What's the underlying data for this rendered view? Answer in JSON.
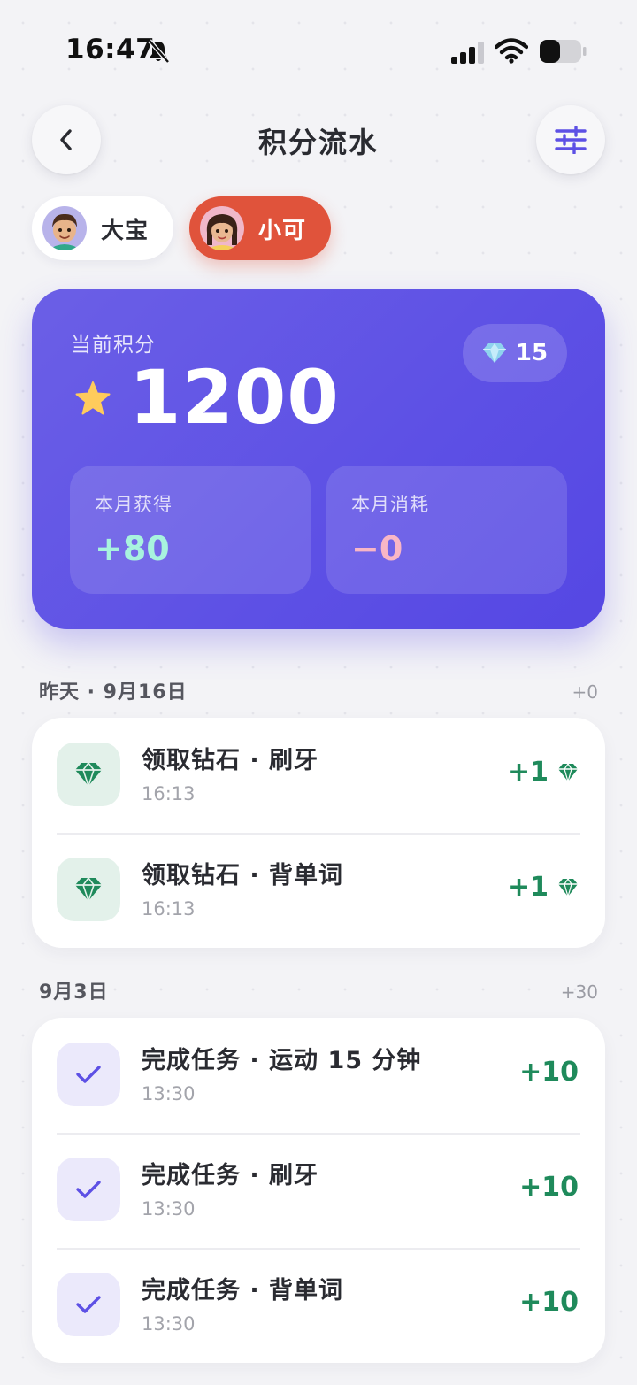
{
  "status_bar": {
    "time": "16:47"
  },
  "header": {
    "title": "积分流水"
  },
  "children": [
    {
      "name": "大宝",
      "active": false
    },
    {
      "name": "小可",
      "active": true
    }
  ],
  "points_card": {
    "label": "当前积分",
    "points": "1200",
    "gems": "15",
    "earned_label": "本月获得",
    "earned_value": "+80",
    "spent_label": "本月消耗",
    "spent_value": "−0"
  },
  "groups": [
    {
      "date": "昨天 · 9月16日",
      "total": "+0",
      "entries": [
        {
          "type": "gem",
          "title": "领取钻石 · 刷牙",
          "time": "16:13",
          "delta": "+1"
        },
        {
          "type": "gem",
          "title": "领取钻石 · 背单词",
          "time": "16:13",
          "delta": "+1"
        }
      ]
    },
    {
      "date": "9月3日",
      "total": "+30",
      "entries": [
        {
          "type": "task",
          "title": "完成任务 · 运动 15 分钟",
          "time": "13:30",
          "delta": "+10"
        },
        {
          "type": "task",
          "title": "完成任务 · 刷牙",
          "time": "13:30",
          "delta": "+10"
        },
        {
          "type": "task",
          "title": "完成任务 · 背单词",
          "time": "13:30",
          "delta": "+10"
        }
      ]
    }
  ],
  "colors": {
    "accent_purple": "#5d50e5",
    "active_tab": "#e0533b",
    "positive_green": "#1f8a5b",
    "earned_mint": "#a8f3de",
    "spent_pink": "#f8b6c6"
  },
  "icons": [
    "bell-slash-icon",
    "signal-icon",
    "wifi-icon",
    "battery-icon",
    "back-icon",
    "sliders-icon",
    "star-icon",
    "diamond-icon",
    "check-icon"
  ]
}
